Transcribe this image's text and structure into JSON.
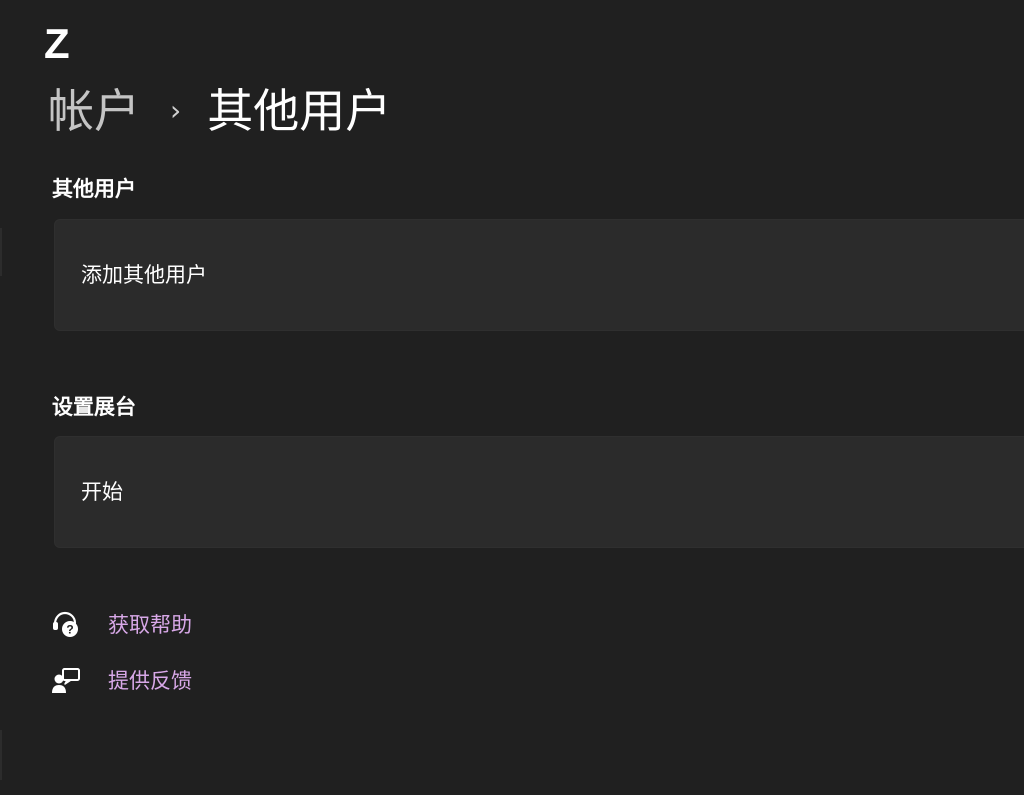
{
  "user": {
    "initial": "Z"
  },
  "breadcrumb": {
    "parent": "帐户",
    "separator": "›",
    "current": "其他用户"
  },
  "sections": [
    {
      "title": "其他用户",
      "card_label": "添加其他用户"
    },
    {
      "title": "设置展台",
      "card_label": "开始"
    }
  ],
  "links": [
    {
      "label": "获取帮助",
      "icon": "get-help-icon"
    },
    {
      "label": "提供反馈",
      "icon": "give-feedback-icon"
    }
  ],
  "colors": {
    "background": "#202020",
    "card": "#2b2b2b",
    "link": "#d8a8e8",
    "muted_text": "#c4c4c4"
  }
}
